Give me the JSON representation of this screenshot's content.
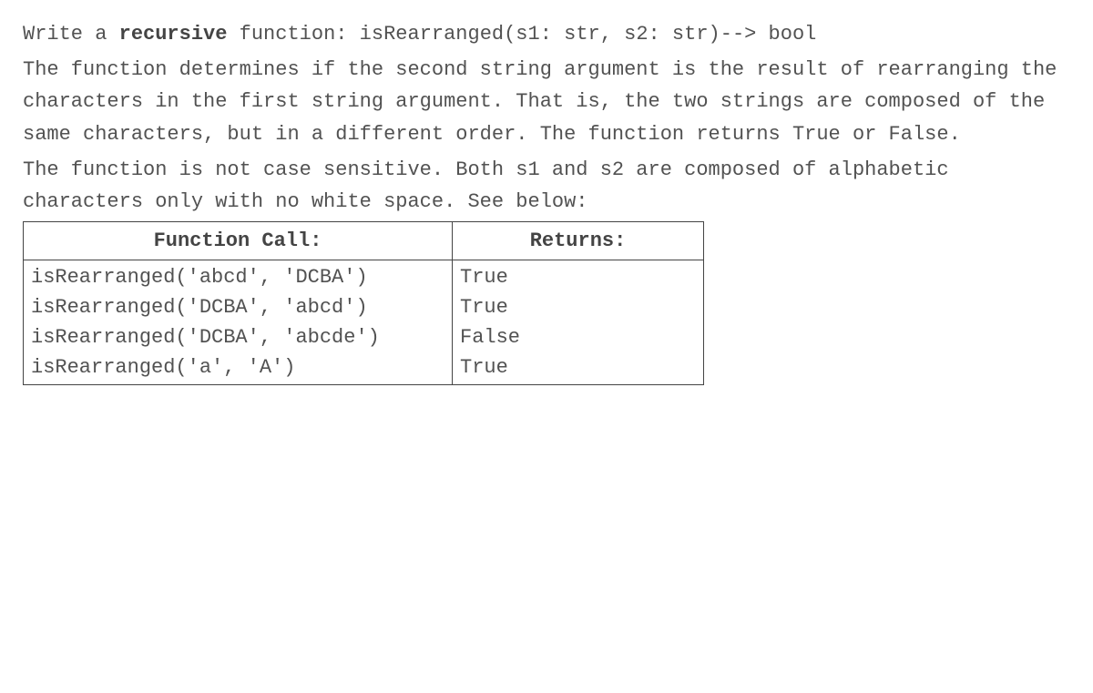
{
  "intro": {
    "prefix": "Write a ",
    "bold": "recursive",
    "suffix": " function: isRearranged(s1: str, s2: str)--> bool"
  },
  "description": "The function determines if the second string argument is the result of rearranging the characters in the first string argument. That is, the two strings are composed of the same characters, but in a different order. The function returns True or False.",
  "note": "The function is not case sensitive. Both s1 and s2 are composed of alphabetic characters only with no white space. See below:",
  "table": {
    "header_call": "Function Call:",
    "header_returns": "Returns:",
    "calls_block": "isRearranged('abcd', 'DCBA')\nisRearranged('DCBA', 'abcd')\nisRearranged('DCBA', 'abcde')\nisRearranged('a', 'A')",
    "returns_block": "True\nTrue\nFalse\nTrue"
  }
}
